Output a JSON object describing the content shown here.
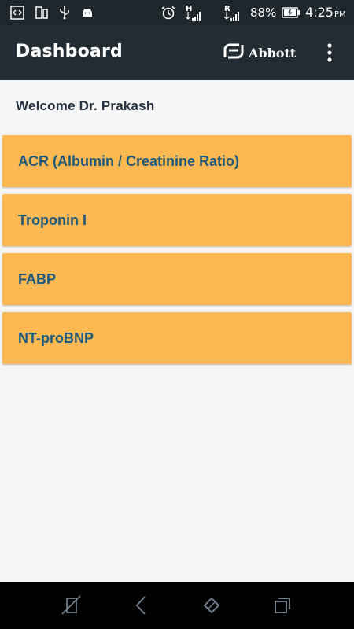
{
  "status_bar": {
    "battery_percent": "88%",
    "time": "4:25",
    "time_suffix": "PM",
    "network_h": "H",
    "network_r": "R"
  },
  "app_bar": {
    "title": "Dashboard",
    "brand": "Abbott"
  },
  "welcome": "Welcome Dr. Prakash",
  "tests": [
    {
      "label": "ACR (Albumin / Creatinine Ratio)"
    },
    {
      "label": "Troponin I"
    },
    {
      "label": "FABP"
    },
    {
      "label": "NT-proBNP"
    }
  ],
  "colors": {
    "app_bar": "#232b33",
    "card": "#fcb853",
    "card_text": "#1e5b7c",
    "background": "#f5f5f5"
  }
}
